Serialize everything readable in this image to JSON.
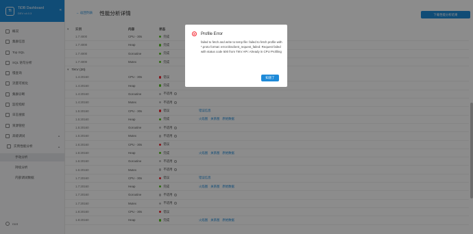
{
  "brand": {
    "title": "TiDB Dashboard",
    "version": "DEV v4.0.3",
    "logo": "Ti",
    "collapse": "«"
  },
  "nav": [
    {
      "label": "概况",
      "icon": "overview-icon",
      "type": "main"
    },
    {
      "label": "集群信息",
      "icon": "cluster-icon",
      "type": "main"
    },
    {
      "label": "Top SQL",
      "icon": "topsql-icon",
      "type": "main"
    },
    {
      "label": "SQL 语句分析",
      "icon": "statement-icon",
      "type": "main"
    },
    {
      "label": "慢查询",
      "icon": "slow-query-icon",
      "type": "main"
    },
    {
      "label": "流量可视化",
      "icon": "keyviz-icon",
      "type": "main"
    },
    {
      "label": "集群诊断",
      "icon": "diagnose-icon",
      "type": "main"
    },
    {
      "label": "监控指标",
      "icon": "monitoring-icon",
      "type": "main"
    },
    {
      "label": "日志搜索",
      "icon": "search-logs-icon",
      "type": "main"
    },
    {
      "label": "资源管控",
      "icon": "resource-icon",
      "type": "main"
    },
    {
      "label": "高级调试",
      "icon": "debug-icon",
      "type": "main",
      "chevron": "▲"
    },
    {
      "label": "实例性能分析",
      "icon": "profiling-icon",
      "type": "sub",
      "chevron": "▲"
    },
    {
      "label": "手动分析",
      "type": "subsub",
      "active": true
    },
    {
      "label": "持续分析",
      "type": "subsub"
    },
    {
      "label": "内部调试数据",
      "type": "subsub"
    }
  ],
  "user": {
    "name": "root"
  },
  "header": {
    "back": "← 返回列表",
    "title": "性能分析详情",
    "download": "下载性能分析结果"
  },
  "columns": {
    "instance": "实例",
    "kind": "内容",
    "status": "状态"
  },
  "groups": {
    "tikv": "TiKV (20)"
  },
  "tidb_rows": [
    {
      "inst": "1.7:4000",
      "kind": "CPU - 30s",
      "status": "完成",
      "dot": "ok"
    },
    {
      "inst": "1.7:4000",
      "kind": "Heap",
      "status": "完成",
      "dot": "ok"
    },
    {
      "inst": "1.7:4000",
      "kind": "Goroutine",
      "status": "完成",
      "dot": "ok"
    },
    {
      "inst": "1.7:4000",
      "kind": "Mutex",
      "status": "完成",
      "dot": "ok"
    }
  ],
  "tikv_rows": [
    {
      "inst": "1.4:20160",
      "kind": "CPU - 30s",
      "status": "错误",
      "dot": "err",
      "actions": []
    },
    {
      "inst": "1.4:20160",
      "kind": "Heap",
      "status": "完成",
      "dot": "ok",
      "actions": [
        "火焰图",
        "关系图",
        "原始数据"
      ]
    },
    {
      "inst": "1.4:20160",
      "kind": "Goroutine",
      "status": "不适用",
      "dot": "na",
      "actions": []
    },
    {
      "inst": "1.4:20160",
      "kind": "Mutex",
      "status": "不适用",
      "dot": "na",
      "actions": []
    },
    {
      "inst": "1.5:20160",
      "kind": "CPU - 30s",
      "status": "错误",
      "dot": "err",
      "actions": [
        "错误信息"
      ]
    },
    {
      "inst": "1.5:20160",
      "kind": "Heap",
      "status": "完成",
      "dot": "ok",
      "actions": [
        "火焰图",
        "关系图",
        "原始数据"
      ]
    },
    {
      "inst": "1.5:20160",
      "kind": "Goroutine",
      "status": "不适用",
      "dot": "na",
      "actions": []
    },
    {
      "inst": "1.5:20160",
      "kind": "Mutex",
      "status": "不适用",
      "dot": "na",
      "actions": []
    },
    {
      "inst": "1.6:20160",
      "kind": "CPU - 30s",
      "status": "错误",
      "dot": "err",
      "actions": []
    },
    {
      "inst": "1.6:20160",
      "kind": "Heap",
      "status": "完成",
      "dot": "ok",
      "actions": [
        "火焰图",
        "关系图",
        "原始数据"
      ]
    },
    {
      "inst": "1.6:20160",
      "kind": "Goroutine",
      "status": "不适用",
      "dot": "na",
      "actions": []
    },
    {
      "inst": "1.6:20160",
      "kind": "Mutex",
      "status": "不适用",
      "dot": "na",
      "actions": []
    },
    {
      "inst": "1.7:20160",
      "kind": "CPU - 30s",
      "status": "错误",
      "dot": "err",
      "actions": [
        "错误信息"
      ]
    },
    {
      "inst": "1.7:20160",
      "kind": "Heap",
      "status": "完成",
      "dot": "ok",
      "actions": [
        "火焰图",
        "关系图",
        "原始数据"
      ]
    },
    {
      "inst": "1.7:20160",
      "kind": "Goroutine",
      "status": "不适用",
      "dot": "na",
      "actions": []
    },
    {
      "inst": "1.7:20160",
      "kind": "Mutex",
      "status": "不适用",
      "dot": "na",
      "actions": []
    },
    {
      "inst": "1.8:20160",
      "kind": "CPU - 30s",
      "status": "错误",
      "dot": "err",
      "actions": []
    },
    {
      "inst": "1.8:20160",
      "kind": "Heap",
      "status": "完成",
      "dot": "ok",
      "actions": [
        "火焰图",
        "关系图",
        "原始数据"
      ]
    }
  ],
  "modal": {
    "title": "Profile Error",
    "icon": "⊘",
    "message": "failed to fetch and write to temp file: failed to fetch profile with *.proto format: error.tiksclient_request_failed: Request failed with status code 500 from TiKV API: Already in CPU Profiling",
    "ok": "知道了"
  },
  "colors": {
    "accent": "#1e8ad8",
    "error": "#f5222d",
    "success": "#52c41a"
  }
}
